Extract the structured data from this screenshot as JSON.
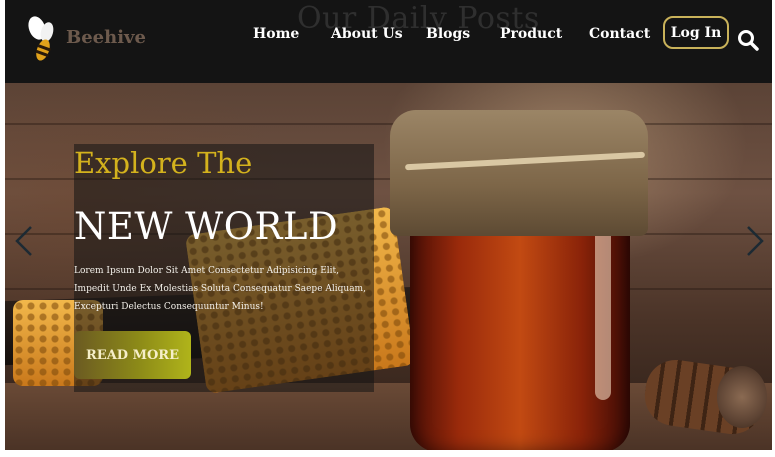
{
  "header": {
    "ghost_heading": "Our Daily Posts",
    "logo_text": "Beehive",
    "nav": [
      "Home",
      "About Us",
      "Blogs",
      "Product",
      "Contact"
    ],
    "login_label": "Log In",
    "search_icon": "search-icon"
  },
  "hero": {
    "kicker": "Explore The",
    "headline": "NEW WORLD",
    "description": "Lorem Ipsum Dolor Sit Amet Consectetur Adipisicing Elit, Impedit Unde Ex Molestias Soluta Consequatur Saepe Aliquam, Excepturi Delectus Consequuntur Minus!",
    "cta_label": "READ MORE",
    "prev_icon": "chevron-left-icon",
    "next_icon": "chevron-right-icon"
  },
  "colors": {
    "header_bg": "#141414",
    "accent_gold": "#d4b21d",
    "login_border": "#c9b25a",
    "logo_text": "#6d5a4d"
  }
}
